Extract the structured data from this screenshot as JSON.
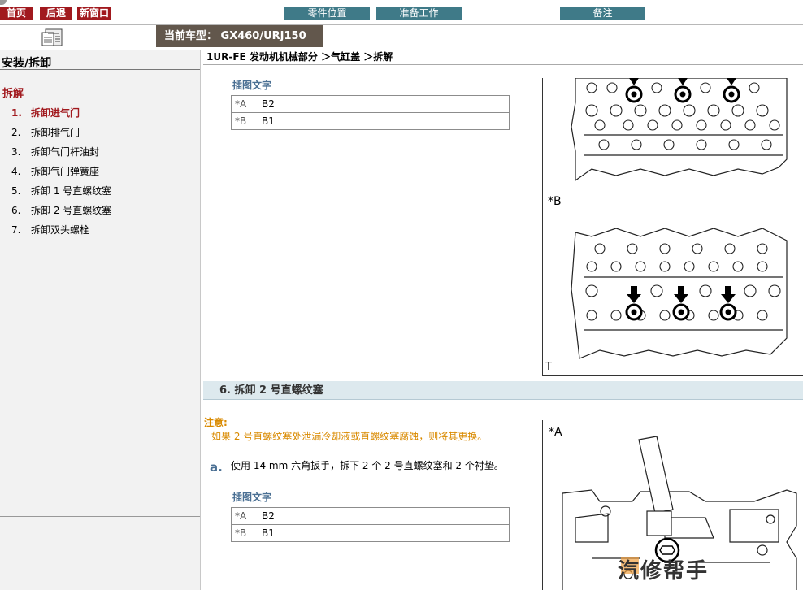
{
  "nav": {
    "home": "首页",
    "back": "后退",
    "new_window": "新窗口",
    "parts_location": "零件位置",
    "preparation": "准备工作",
    "notes": "备注"
  },
  "car_model": "当前车型： GX460/URJ150",
  "sidebar": {
    "title": "安装/拆卸",
    "subtitle": "拆解",
    "items": [
      {
        "num": "1.",
        "label": "拆卸进气门"
      },
      {
        "num": "2.",
        "label": "拆卸排气门"
      },
      {
        "num": "3.",
        "label": "拆卸气门杆油封"
      },
      {
        "num": "4.",
        "label": "拆卸气门弹簧座"
      },
      {
        "num": "5.",
        "label": "拆卸 1 号直螺纹塞"
      },
      {
        "num": "6.",
        "label": "拆卸 2 号直螺纹塞"
      },
      {
        "num": "7.",
        "label": "拆卸双头螺栓"
      }
    ]
  },
  "breadcrumb": "1UR-FE 发动机机械部分 ＞气缸盖 ＞拆解",
  "figure1": {
    "caption": "插图文字",
    "rows": [
      {
        "key": "*A",
        "value": "B2"
      },
      {
        "key": "*B",
        "value": "B1"
      }
    ],
    "label_b": "*B",
    "label_t": "T"
  },
  "section6": {
    "heading": "6. 拆卸 2 号直螺纹塞",
    "note_title": "注意:",
    "note_text": "如果 2 号直螺纹塞处泄漏冷却液或直螺纹塞腐蚀，则将其更换。",
    "step_letter": "a.",
    "step_text": "使用 14 mm 六角扳手，拆下 2 个 2 号直螺纹塞和 2 个衬垫。",
    "caption": "插图文字",
    "rows": [
      {
        "key": "*A",
        "value": "B2"
      },
      {
        "key": "*B",
        "value": "B1"
      }
    ],
    "label_a": "*A"
  },
  "watermark": "汽修帮手",
  "colors": {
    "accent_red": "#a1191e",
    "teal": "#3f7a88",
    "caption_blue": "#4a6f93",
    "note_orange": "#d98a00"
  }
}
